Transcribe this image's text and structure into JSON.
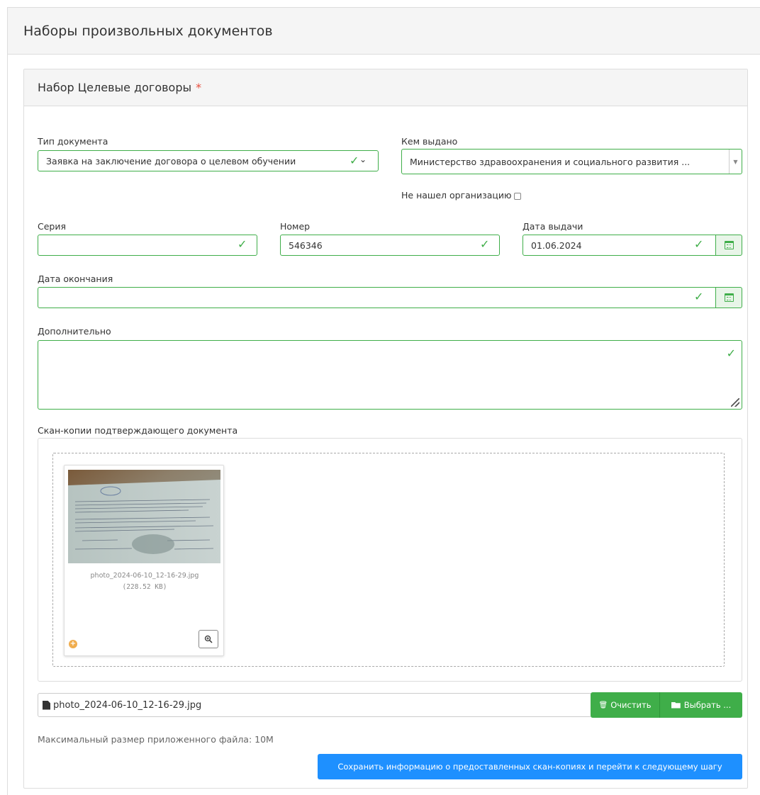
{
  "page": {
    "title": "Наборы произвольных документов"
  },
  "panel": {
    "title": "Набор Целевые договоры",
    "required_mark": "*"
  },
  "form": {
    "doc_type": {
      "label": "Тип документа",
      "value": "Заявка на заключение договора о целевом обучении"
    },
    "issued_by": {
      "label": "Кем выдано",
      "value": "Министерство здравоохранения и социального развития ...",
      "not_found_label": "Не нашел организацию"
    },
    "series": {
      "label": "Серия",
      "value": ""
    },
    "number": {
      "label": "Номер",
      "value": "546346"
    },
    "issue_date": {
      "label": "Дата выдачи",
      "value": "01.06.2024"
    },
    "end_date": {
      "label": "Дата окончания",
      "value": ""
    },
    "additional": {
      "label": "Дополнительно",
      "value": ""
    }
  },
  "upload": {
    "label": "Скан-копии подтверждающего документа",
    "file_name": "photo_2024-06-10_12-16-29.jpg",
    "file_size": "(228.52 KB)",
    "clear_label": "Очистить",
    "browse_label": "Выбрать ...",
    "max_size_note": "Максимальный размер приложенного файла: 10M"
  },
  "submit_label": "Сохранить информацию о предоставленных скан-копиях и перейти к следующему шагу",
  "colors": {
    "valid_green": "#3fae49",
    "primary_blue": "#1e90ff",
    "required_red": "#e74c3c"
  }
}
